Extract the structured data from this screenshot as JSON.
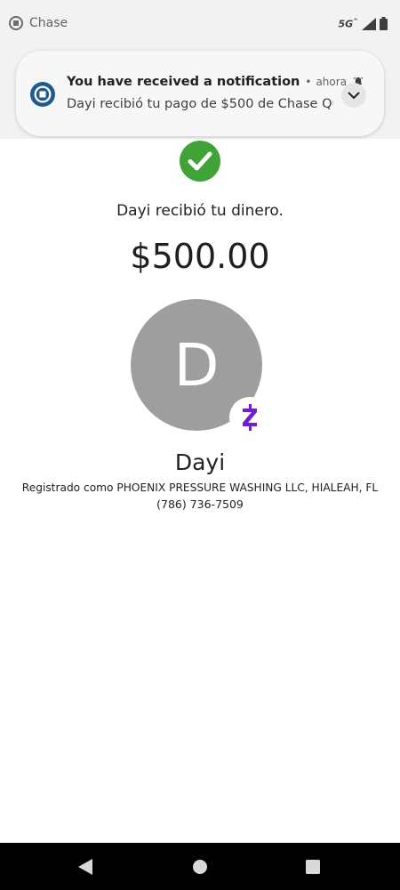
{
  "status_bar": {
    "app_name": "Chase",
    "network": "5G",
    "icons": [
      "chase-logo-icon",
      "signal-icon",
      "battery-icon"
    ]
  },
  "notification": {
    "icon": "chase-logo-icon",
    "title": "You have received a notification",
    "separator": "•",
    "time": "ahora",
    "bell_icon": "bell-icon",
    "body": "Dayi recibió tu pago de $500 de Chase Qu..",
    "expand_icon": "chevron-down-icon"
  },
  "payment": {
    "status_icon": "check-circle-icon",
    "message": "Dayi recibió tu dinero.",
    "amount": "$500.00"
  },
  "recipient": {
    "initial": "D",
    "badge_icon": "zelle-icon",
    "name": "Dayi",
    "registered_as": "Registrado como PHOENIX PRESSURE WASHING LLC, HIALEAH, FL",
    "phone": "(786) 736-7509"
  },
  "navigation": {
    "icons": [
      "back-icon",
      "home-icon",
      "recents-icon"
    ]
  },
  "colors": {
    "success_green": "#3fa337",
    "chase_blue": "#1f5b8f",
    "zelle_purple": "#6d1ed4",
    "avatar_gray": "#9e9e9e"
  }
}
